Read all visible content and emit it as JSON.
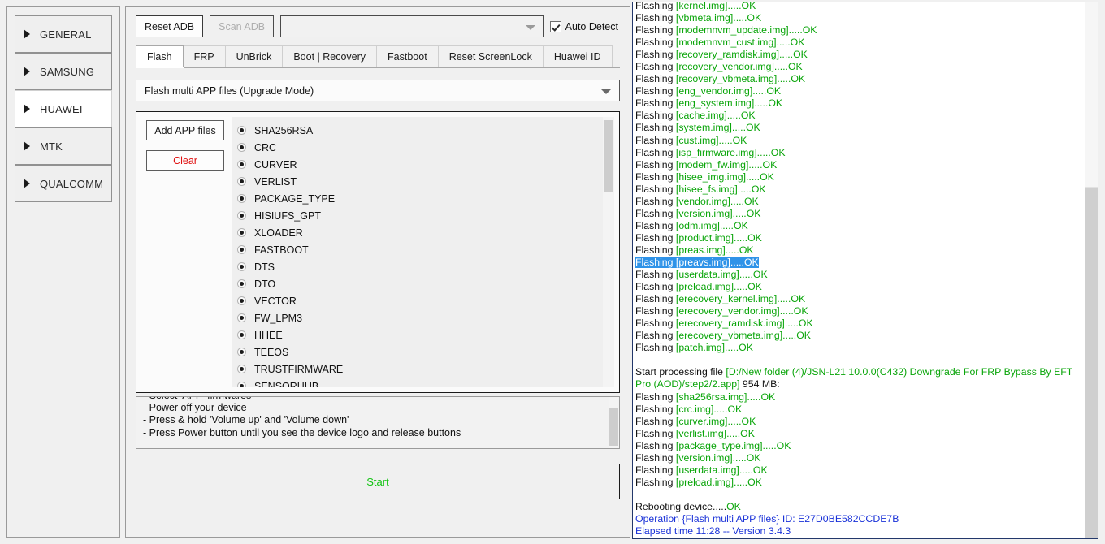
{
  "sidebar": {
    "items": [
      {
        "label": "GENERAL",
        "active": false
      },
      {
        "label": "SAMSUNG",
        "active": false
      },
      {
        "label": "HUAWEI",
        "active": true
      },
      {
        "label": "MTK",
        "active": false
      },
      {
        "label": "QUALCOMM",
        "active": false
      }
    ]
  },
  "toolbar": {
    "reset_adb_label": "Reset ADB",
    "scan_adb_label": "Scan ADB",
    "device_combo_value": "",
    "auto_detect_label": "Auto Detect",
    "auto_detect_checked": true
  },
  "tabs": [
    {
      "label": "Flash",
      "active": true
    },
    {
      "label": "FRP",
      "active": false
    },
    {
      "label": "UnBrick",
      "active": false
    },
    {
      "label": "Boot | Recovery",
      "active": false
    },
    {
      "label": "Fastboot",
      "active": false
    },
    {
      "label": "Reset ScreenLock",
      "active": false
    },
    {
      "label": "Huawei ID",
      "active": false
    }
  ],
  "mode_select": {
    "value": "Flash multi APP files (Upgrade Mode)"
  },
  "file_panel": {
    "add_label": "Add APP files",
    "clear_label": "Clear",
    "items": [
      "SHA256RSA",
      "CRC",
      "CURVER",
      "VERLIST",
      "PACKAGE_TYPE",
      "HISIUFS_GPT",
      "XLOADER",
      "FASTBOOT",
      "DTS",
      "DTO",
      "VECTOR",
      "FW_LPM3",
      "HHEE",
      "TEEOS",
      "TRUSTFIRMWARE",
      "SENSORHUB"
    ]
  },
  "instructions": {
    "lines": [
      "- Select 'APP' firmwares",
      "- Power off your device",
      "- Press & hold 'Volume up' and 'Volume down'",
      "- Press Power button until you see the device logo and release buttons"
    ]
  },
  "start_button": {
    "label": "Start"
  },
  "colors": {
    "accent_green": "#0aa50a",
    "accent_blue": "#1a32d8",
    "selection_blue": "#2f93e8",
    "start_green": "#12c312",
    "clear_red": "#e01010"
  },
  "log": {
    "lines": [
      {
        "type": "flash",
        "prefix": "Flashing ",
        "file": "[kernel.img].....OK",
        "clipped": true
      },
      {
        "type": "flash",
        "prefix": "Flashing ",
        "file": "[vbmeta.img].....OK"
      },
      {
        "type": "flash",
        "prefix": "Flashing ",
        "file": "[modemnvm_update.img].....OK"
      },
      {
        "type": "flash",
        "prefix": "Flashing ",
        "file": "[modemnvm_cust.img].....OK"
      },
      {
        "type": "flash",
        "prefix": "Flashing ",
        "file": "[recovery_ramdisk.img].....OK"
      },
      {
        "type": "flash",
        "prefix": "Flashing ",
        "file": "[recovery_vendor.img].....OK"
      },
      {
        "type": "flash",
        "prefix": "Flashing ",
        "file": "[recovery_vbmeta.img].....OK"
      },
      {
        "type": "flash",
        "prefix": "Flashing ",
        "file": "[eng_vendor.img].....OK"
      },
      {
        "type": "flash",
        "prefix": "Flashing ",
        "file": "[eng_system.img].....OK"
      },
      {
        "type": "flash",
        "prefix": "Flashing ",
        "file": "[cache.img].....OK"
      },
      {
        "type": "flash",
        "prefix": "Flashing ",
        "file": "[system.img].....OK"
      },
      {
        "type": "flash",
        "prefix": "Flashing ",
        "file": "[cust.img].....OK"
      },
      {
        "type": "flash",
        "prefix": "Flashing ",
        "file": "[isp_firmware.img].....OK"
      },
      {
        "type": "flash",
        "prefix": "Flashing ",
        "file": "[modem_fw.img].....OK"
      },
      {
        "type": "flash",
        "prefix": "Flashing ",
        "file": "[hisee_img.img].....OK"
      },
      {
        "type": "flash",
        "prefix": "Flashing ",
        "file": "[hisee_fs.img].....OK"
      },
      {
        "type": "flash",
        "prefix": "Flashing ",
        "file": "[vendor.img].....OK"
      },
      {
        "type": "flash",
        "prefix": "Flashing ",
        "file": "[version.img].....OK"
      },
      {
        "type": "flash",
        "prefix": "Flashing ",
        "file": "[odm.img].....OK"
      },
      {
        "type": "flash",
        "prefix": "Flashing ",
        "file": "[product.img].....OK"
      },
      {
        "type": "flash",
        "prefix": "Flashing ",
        "file": "[preas.img].....OK"
      },
      {
        "type": "flash-selected",
        "prefix": "Flashing ",
        "file": "[preavs.img].....OK"
      },
      {
        "type": "flash",
        "prefix": "Flashing ",
        "file": "[userdata.img].....OK"
      },
      {
        "type": "flash",
        "prefix": "Flashing ",
        "file": "[preload.img].....OK"
      },
      {
        "type": "flash",
        "prefix": "Flashing ",
        "file": "[erecovery_kernel.img].....OK"
      },
      {
        "type": "flash",
        "prefix": "Flashing ",
        "file": "[erecovery_vendor.img].....OK"
      },
      {
        "type": "flash",
        "prefix": "Flashing ",
        "file": "[erecovery_ramdisk.img].....OK"
      },
      {
        "type": "flash",
        "prefix": "Flashing ",
        "file": "[erecovery_vbmeta.img].....OK"
      },
      {
        "type": "flash",
        "prefix": "Flashing ",
        "file": "[patch.img].....OK"
      },
      {
        "type": "blank"
      },
      {
        "type": "processing",
        "prefix": "Start processing file ",
        "path": "[D:/New folder (4)/JSN-L21 10.0.0(C432) Downgrade For FRP Bypass By EFT Pro (AOD)/step2/2.app]",
        "suffix": " 954 MB:"
      },
      {
        "type": "flash",
        "prefix": "Flashing ",
        "file": "[sha256rsa.img].....OK"
      },
      {
        "type": "flash",
        "prefix": "Flashing ",
        "file": "[crc.img].....OK"
      },
      {
        "type": "flash",
        "prefix": "Flashing ",
        "file": "[curver.img].....OK"
      },
      {
        "type": "flash",
        "prefix": "Flashing ",
        "file": "[verlist.img].....OK"
      },
      {
        "type": "flash",
        "prefix": "Flashing ",
        "file": "[package_type.img].....OK"
      },
      {
        "type": "flash",
        "prefix": "Flashing ",
        "file": "[version.img].....OK"
      },
      {
        "type": "flash",
        "prefix": "Flashing ",
        "file": "[userdata.img].....OK"
      },
      {
        "type": "flash",
        "prefix": "Flashing ",
        "file": "[preload.img].....OK"
      },
      {
        "type": "blank"
      },
      {
        "type": "reboot",
        "prefix": "Rebooting device.....",
        "status": "OK"
      },
      {
        "type": "info",
        "text": "Operation {Flash multi APP files} ID: E27D0BE582CCDE7B"
      },
      {
        "type": "info",
        "text": "Elapsed time 11:28 -- Version 3.4.3"
      }
    ]
  }
}
